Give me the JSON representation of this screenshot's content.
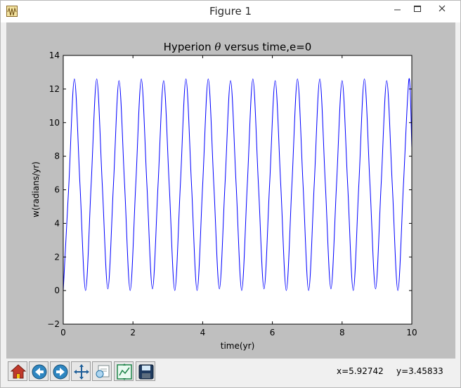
{
  "window": {
    "title": "Figure 1",
    "app_icon": "matplotlib-figure-icon",
    "controls": [
      "minimize-icon",
      "maximize-icon",
      "close-icon"
    ]
  },
  "toolbar": {
    "buttons": [
      {
        "id": "home",
        "icon": "home-icon"
      },
      {
        "id": "back",
        "icon": "arrow-left-icon"
      },
      {
        "id": "forward",
        "icon": "arrow-right-icon"
      },
      {
        "id": "pan",
        "icon": "move-arrows-icon"
      },
      {
        "id": "zoom",
        "icon": "zoom-rectangle-icon"
      },
      {
        "id": "configure",
        "icon": "configure-subplots-icon"
      },
      {
        "id": "save",
        "icon": "floppy-disk-icon"
      }
    ],
    "x_readout": "x=5.92742",
    "y_readout": "y=3.45833"
  },
  "colors": {
    "figure_background": "#bfbfbf",
    "axes_background": "#ffffff",
    "line": "#0000ff"
  },
  "chart_data": {
    "type": "line",
    "title_prefix": "Hyperion ",
    "title_symbol": "θ",
    "title_suffix": " versus time,e=0",
    "xlabel": "time(yr)",
    "ylabel": "w(radians/yr)",
    "xlim": [
      0,
      10
    ],
    "ylim": [
      -2,
      14
    ],
    "xticks": [
      0,
      2,
      4,
      6,
      8,
      10
    ],
    "yticks": [
      -2,
      0,
      2,
      4,
      6,
      8,
      10,
      12,
      14
    ],
    "grid": false,
    "legend": "none",
    "series": [
      {
        "x": [
          0,
          0.16,
          0.32,
          0.48,
          0.64,
          0.8,
          0.96,
          1.12,
          1.28,
          1.44,
          1.6,
          1.76,
          1.92,
          2.08,
          2.24,
          2.4,
          2.56,
          2.72,
          2.88,
          3.04,
          3.2,
          3.36,
          3.52,
          3.68,
          3.84,
          4.0,
          4.16,
          4.32,
          4.48,
          4.64,
          4.8,
          4.96,
          5.12,
          5.28,
          5.44,
          5.6,
          5.76,
          5.92,
          6.08,
          6.24,
          6.4,
          6.56,
          6.72,
          6.88,
          7.04,
          7.2,
          7.36,
          7.52,
          7.68,
          7.84,
          8.0,
          8.16,
          8.32,
          8.48,
          8.64,
          8.8,
          8.96,
          9.12,
          9.28,
          9.44,
          9.6,
          9.76,
          9.92,
          10.0
        ],
        "y": [
          0.0,
          6.3,
          12.6,
          6.3,
          0.0,
          6.3,
          12.6,
          6.3,
          0.1,
          6.3,
          12.5,
          6.3,
          0.0,
          6.3,
          12.6,
          6.3,
          0.1,
          6.3,
          12.5,
          6.3,
          0.0,
          6.3,
          12.6,
          6.3,
          0.0,
          6.3,
          12.6,
          6.3,
          0.1,
          6.3,
          12.5,
          6.3,
          0.0,
          6.3,
          12.6,
          6.3,
          0.1,
          6.3,
          12.5,
          6.3,
          0.0,
          6.3,
          12.6,
          6.3,
          0.0,
          6.3,
          12.6,
          6.3,
          0.1,
          6.3,
          12.5,
          6.3,
          0.0,
          6.3,
          12.6,
          6.3,
          0.1,
          6.3,
          12.5,
          6.3,
          0.0,
          6.3,
          12.6,
          8.5
        ]
      }
    ]
  }
}
